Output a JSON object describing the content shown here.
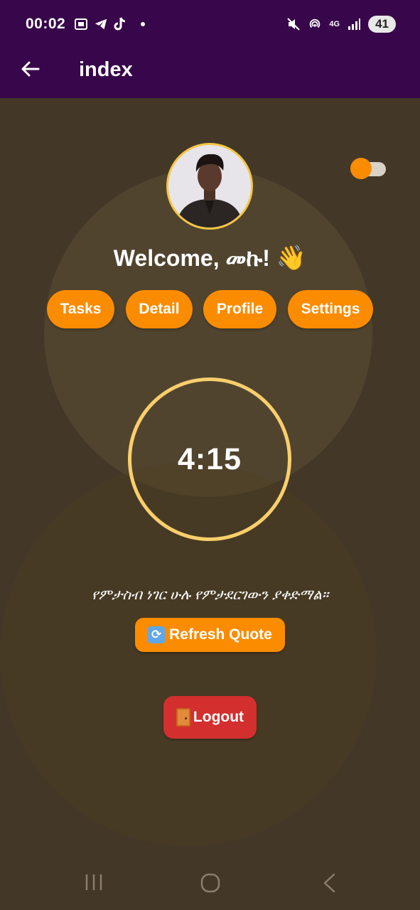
{
  "status_bar": {
    "time": "00:02",
    "network": "4G",
    "battery": "41",
    "icons": [
      "screenshot-icon",
      "telegram-icon",
      "tiktok-icon",
      "notification-dot-icon",
      "mute-icon",
      "hotspot-icon",
      "signal-icon",
      "battery-icon"
    ]
  },
  "app_bar": {
    "title": "index",
    "back_icon": "arrow-left-icon"
  },
  "theme_toggle": {
    "state": "on",
    "accent": "#fb8c00"
  },
  "welcome": {
    "text": "Welcome, መኩ!",
    "emoji": "👋"
  },
  "nav_buttons": [
    {
      "label": "Tasks"
    },
    {
      "label": "Detail"
    },
    {
      "label": "Profile"
    },
    {
      "label": "Settings"
    }
  ],
  "timer": {
    "value": "4:15"
  },
  "quote": {
    "text": "የምታስብ ነገር ሁሉ የምታደርገውን ያቀድማል።"
  },
  "refresh_button": {
    "label": "Refresh Quote",
    "icon": "refresh-icon"
  },
  "logout_button": {
    "label": "Logout",
    "icon": "door-icon"
  },
  "colors": {
    "background": "#433828",
    "topbar": "#38064a",
    "orange": "#fb8c00",
    "red": "#d32f2f",
    "ring": "#f9cf6c"
  }
}
